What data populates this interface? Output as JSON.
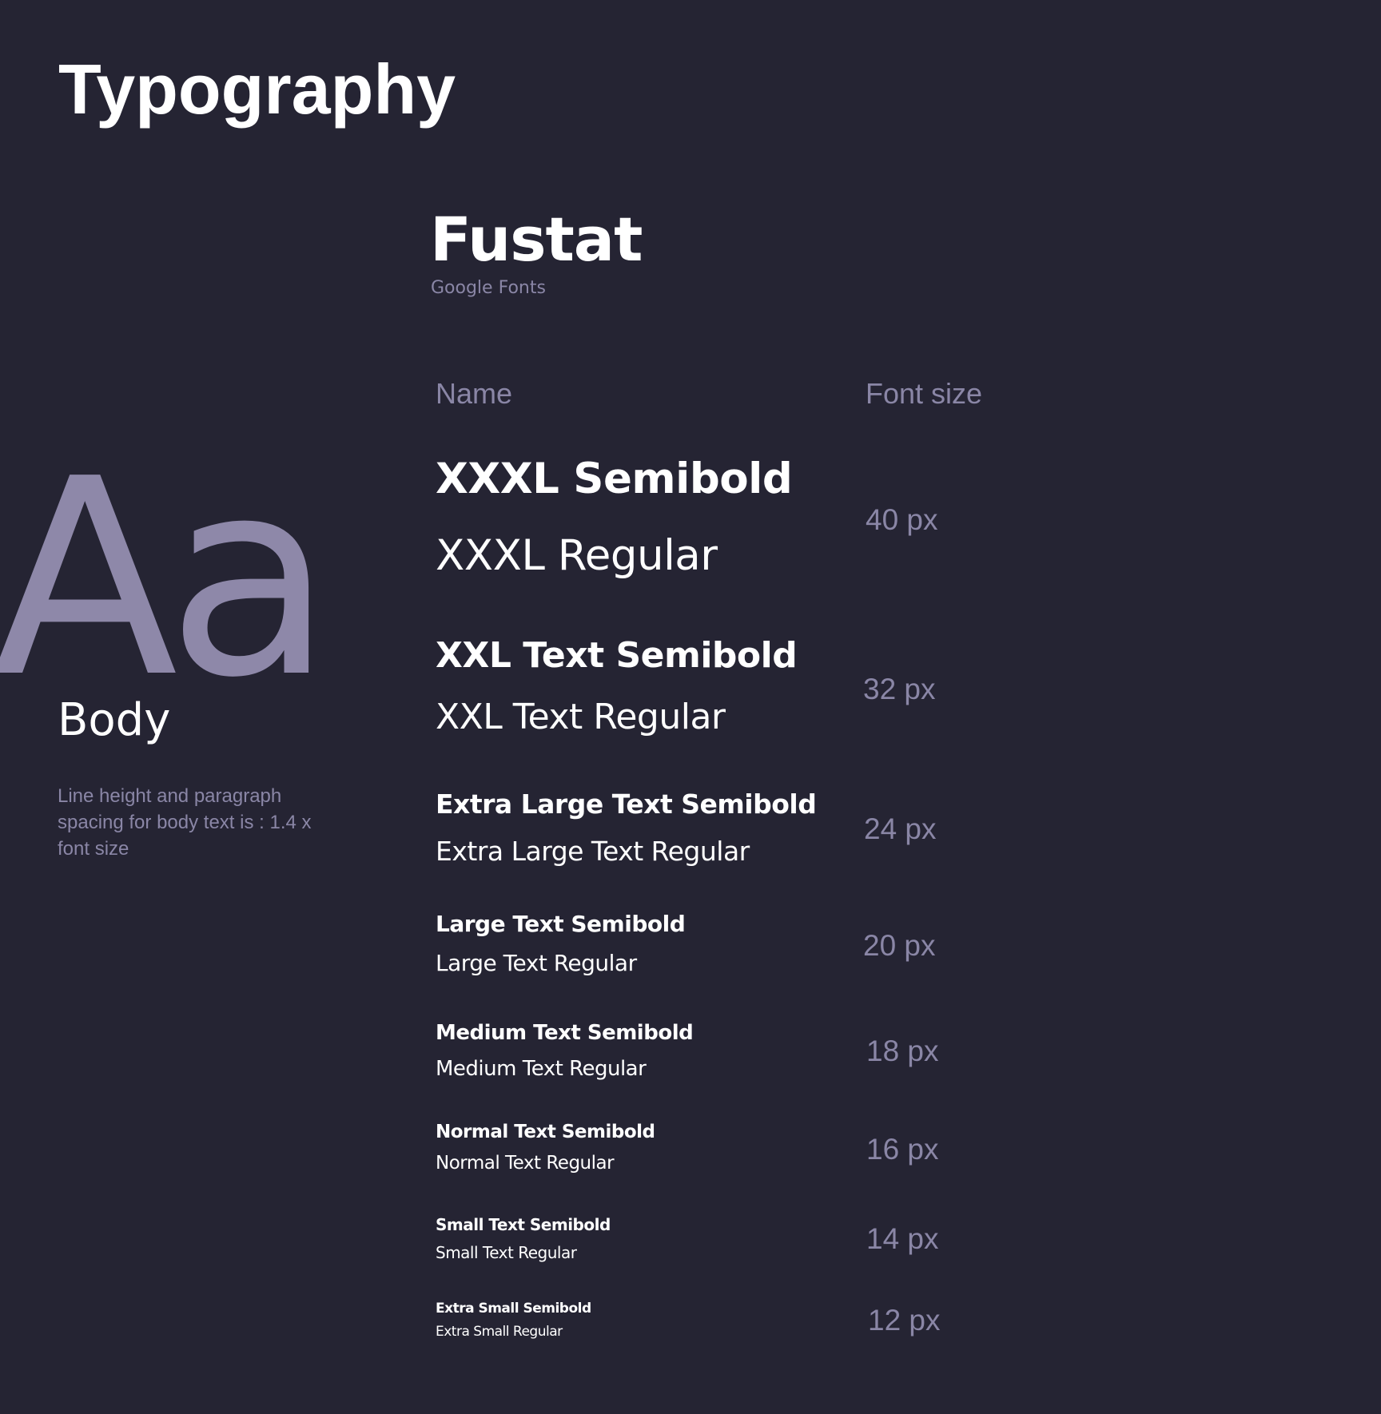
{
  "page": {
    "title": "Typography"
  },
  "font": {
    "name": "Fustat",
    "source": "Google Fonts",
    "sample_glyph": "Aa"
  },
  "body_section": {
    "label": "Body",
    "note": "Line height and paragraph spacing for body text is : 1.4 x font size"
  },
  "table": {
    "headers": {
      "name": "Name",
      "font_size": "Font size"
    },
    "rows": [
      {
        "semibold": "XXXL Semibold",
        "regular": "XXXL Regular",
        "size": "40 px"
      },
      {
        "semibold": "XXL Text Semibold",
        "regular": "XXL Text Regular",
        "size": "32 px"
      },
      {
        "semibold": "Extra Large Text Semibold",
        "regular": "Extra Large Text Regular",
        "size": "24 px"
      },
      {
        "semibold": "Large Text Semibold",
        "regular": "Large Text Regular",
        "size": "20 px"
      },
      {
        "semibold": "Medium Text Semibold",
        "regular": "Medium Text Regular",
        "size": "18 px"
      },
      {
        "semibold": "Normal Text Semibold",
        "regular": "Normal Text Regular",
        "size": "16 px"
      },
      {
        "semibold": "Small Text Semibold",
        "regular": "Small Text Regular",
        "size": "14 px"
      },
      {
        "semibold": "Extra Small Semibold",
        "regular": "Extra Small Regular",
        "size": "12 px"
      }
    ]
  },
  "colors": {
    "background": "#252433",
    "primary_text": "#ffffff",
    "muted_text": "#8a86a6",
    "glyph": "#8e88a9"
  }
}
